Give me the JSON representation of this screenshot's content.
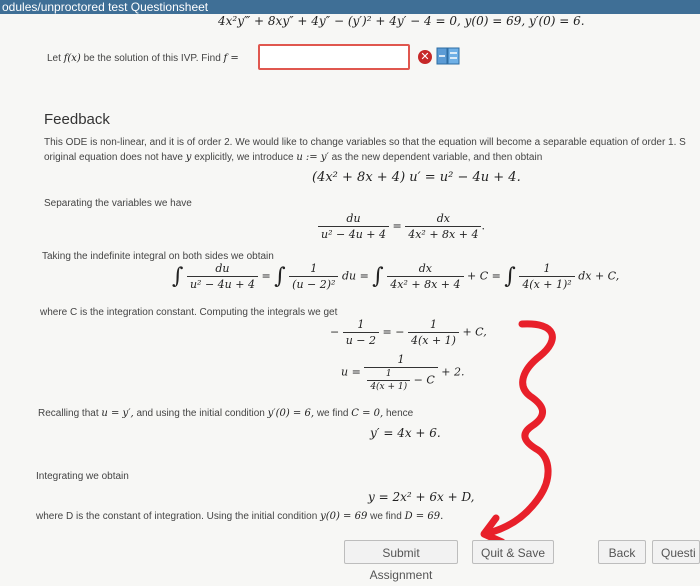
{
  "window": {
    "title": "odules/unproctored test Questionsheet"
  },
  "problem": {
    "ode": "4x²y‴ + 8xy″ + 4y″ − (y′)² + 4y′ − 4 = 0,   y(0) = 69, y′(0) = 6.",
    "prompt_prefix": "Let",
    "prompt_fx": "f(x)",
    "prompt_mid": "be the solution of this IVP. Find",
    "prompt_f": "f =",
    "answer_value": ""
  },
  "feedback": {
    "title": "Feedback",
    "p1_line1": "This ODE is non-linear, and it is of order 2. We would like to change variables so that the equation will become a separable equation of order 1. S",
    "p1_line2a": "original equation does not have",
    "p1_line2b": "explicitly, we introduce",
    "p1_line2c": "as the new dependent variable, and then obtain",
    "eq_sub": "(4x² + 8x + 4) u′ = u² − 4u + 4.",
    "sep_text": "Separating the variables we have",
    "sep_du": "du",
    "sep_du_den": "u² − 4u + 4",
    "sep_dx": "dx",
    "sep_dx_den": "4x² + 8x + 4",
    "int_text": "Taking the indefinite integral on both sides we obtain",
    "int_one": "1",
    "int_u2": "(u − 2)²",
    "int_du_tail": "du =",
    "int_plusC": "+ C =",
    "int_x1": "4(x + 1)²",
    "int_dx_tail": "dx + C,",
    "const_text": "where C is the integration constant. Computing the integrals we get",
    "res_minus": "−",
    "res_u2": "u − 2",
    "res_eq": "= −",
    "res_x1": "4(x + 1)",
    "res_C": "+ C,",
    "u_eq": "u =",
    "u_den_tail": "− C",
    "u_plus2": "+ 2.",
    "recall_a": "Recalling that",
    "recall_u": "u = y′,",
    "recall_b": "and using the initial condition",
    "recall_ic": "y′(0) = 6,",
    "recall_c": "we find",
    "recall_C0": "C = 0,",
    "recall_d": "hence",
    "yprime": "y′ = 4x + 6.",
    "integ_text": "Integrating we obtain",
    "y_sol": "y = 2x² + 6x + D,",
    "d_a": "where D is the constant of integration. Using the initial condition",
    "d_ic": "y(0) = 69",
    "d_b": "we find",
    "d_val": "D = 69."
  },
  "buttons": {
    "submit": "Submit Assignment",
    "quit": "Quit & Save",
    "back": "Back",
    "question": "Questi"
  },
  "colors": {
    "error": "#c62828",
    "annotation": "#e8202a",
    "header": "#3f6f96"
  }
}
